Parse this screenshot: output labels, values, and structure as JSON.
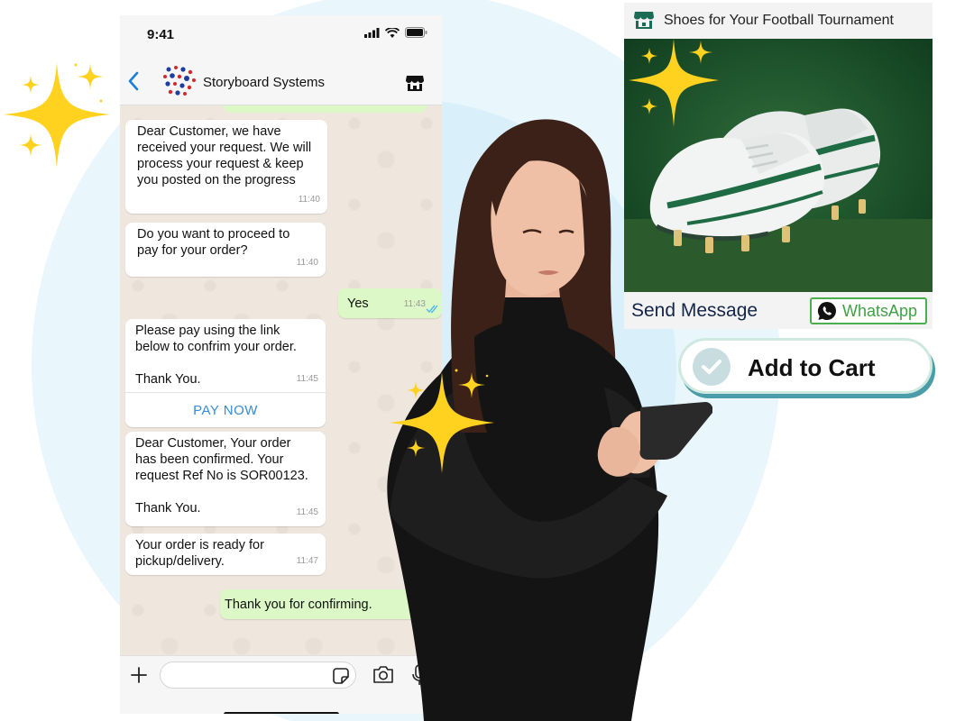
{
  "phone": {
    "status_time": "9:41",
    "contact_name": "Storyboard Systems",
    "message_input_placeholder": "",
    "messages": [
      {
        "text": "Dear Customer, we have\nreceived your request. We will\nprocess your request & keep\nyou posted on the progress",
        "time": "11:40"
      },
      {
        "text": "Do you want to proceed to\npay for your order?",
        "time": "11:40"
      },
      {
        "text": "Yes",
        "time": "11:43"
      },
      {
        "text": "Please pay using the link\nbelow to confrim your order.\n\nThank You.",
        "time": "11:45",
        "action": "PAY NOW"
      },
      {
        "text": "Dear Customer, Your order\nhas been confirmed. Your\nrequest Ref No is SOR00123.\n\nThank You.",
        "time": "11:45"
      },
      {
        "text": "Your order is ready for\npickup/delivery.",
        "time": "11:47"
      },
      {
        "text": "Thank you for confirming."
      }
    ]
  },
  "product_card": {
    "title": "Shoes for Your Football Tournament",
    "send_message_label": "Send Message",
    "whatsapp_label": "WhatsApp"
  },
  "cart": {
    "label": "Add to Cart"
  },
  "colors": {
    "outgoing_bubble": "#dcf8c6",
    "incoming_bubble": "#ffffff",
    "link_blue": "#3a8bd0",
    "whatsapp_green": "#41a145",
    "sparkle_yellow": "#ffd21f"
  }
}
